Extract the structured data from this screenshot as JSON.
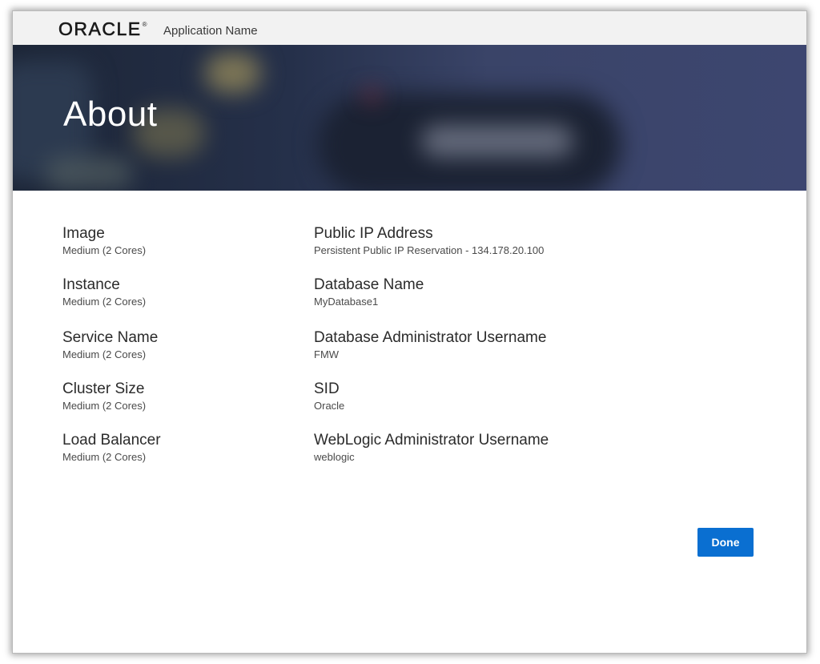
{
  "header": {
    "logo_text": "ORACLE",
    "logo_mark": "®",
    "app_name": "Application Name"
  },
  "hero": {
    "title": "About"
  },
  "details": {
    "left": [
      {
        "label": "Image",
        "value": "Medium (2 Cores)"
      },
      {
        "label": "Instance",
        "value": "Medium (2 Cores)"
      },
      {
        "label": "Service Name",
        "value": "Medium (2 Cores)"
      },
      {
        "label": "Cluster Size",
        "value": "Medium (2 Cores)"
      },
      {
        "label": "Load Balancer",
        "value": "Medium (2 Cores)"
      }
    ],
    "right": [
      {
        "label": "Public IP Address",
        "value": "Persistent Public IP Reservation - 134.178.20.100"
      },
      {
        "label": "Database Name",
        "value": "MyDatabase1"
      },
      {
        "label": "Database Administrator Username",
        "value": "FMW"
      },
      {
        "label": "SID",
        "value": "Oracle"
      },
      {
        "label": "WebLogic Administrator Username",
        "value": "weblogic"
      }
    ]
  },
  "actions": {
    "done_label": "Done"
  },
  "colors": {
    "accent": "#0a6fd1",
    "hero_background": "#3a4468",
    "topbar_background": "#f2f2f2"
  }
}
